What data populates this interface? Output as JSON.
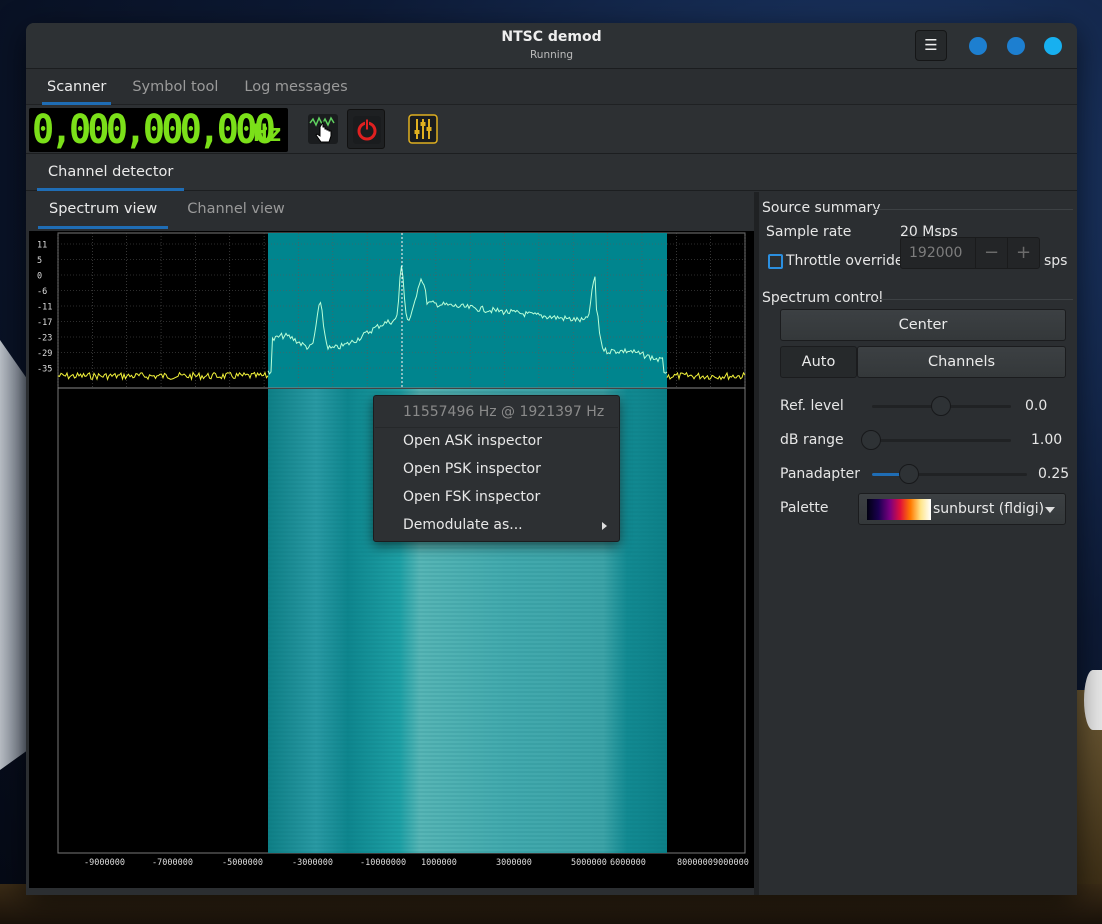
{
  "window": {
    "title": "NTSC demod",
    "subtitle": "Running"
  },
  "main_tabs": [
    {
      "label": "Scanner",
      "active": true
    },
    {
      "label": "Symbol tool",
      "active": false
    },
    {
      "label": "Log messages",
      "active": false
    }
  ],
  "toolbar": {
    "frequency": "0,000,000,000",
    "frequency_unit": "Hz",
    "buttons": [
      {
        "icon": "spectrum-pointer-icon",
        "pressed": false
      },
      {
        "icon": "power-icon",
        "pressed": true
      },
      {
        "icon": "sliders-icon",
        "pressed": false
      }
    ]
  },
  "section_tab": "Channel detector",
  "view_tabs": [
    {
      "label": "Spectrum view",
      "active": true
    },
    {
      "label": "Channel view",
      "active": false
    }
  ],
  "spectrum": {
    "y_ticks": [
      "11",
      "5",
      "0",
      "-6",
      "-11",
      "-17",
      "-23",
      "-29",
      "-35"
    ],
    "x_ticks": [
      "-9000000",
      "-7000000",
      "-5000000",
      "-3000000",
      "-1000000",
      "0",
      "1000000",
      "3000000",
      "5000000",
      "6000000",
      "8000000",
      "9000000"
    ],
    "colors": {
      "trace": "#f2f23a",
      "channel_fill": "#008c96",
      "channel_trace": "#b8ffd8",
      "grid": "#5a5a5a"
    }
  },
  "context_menu": {
    "header": "11557496 Hz @ 1921397 Hz",
    "items": [
      "Open ASK inspector",
      "Open PSK inspector",
      "Open FSK inspector",
      "Demodulate as..."
    ]
  },
  "source_summary": {
    "title": "Source summary",
    "sample_rate_label": "Sample rate",
    "sample_rate_value": "20 Msps",
    "throttle_label": "Throttle override",
    "throttle_checked": false,
    "throttle_value": "192000",
    "throttle_minus": "−",
    "throttle_plus": "+",
    "throttle_unit": "sps"
  },
  "spectrum_control": {
    "title": "Spectrum control",
    "center_label": "Center",
    "auto_label": "Auto",
    "channels_label": "Channels",
    "ref_level_label": "Ref. level",
    "ref_level_value": "0.0",
    "ref_level_fraction": 0.5,
    "db_range_label": "dB range",
    "db_range_value": "1.00",
    "db_range_fraction": 0.0,
    "panadapter_label": "Panadapter",
    "panadapter_value": "0.25",
    "panadapter_fraction": 0.25,
    "palette_label": "Palette",
    "palette_value": "sunburst (fldigi)"
  }
}
